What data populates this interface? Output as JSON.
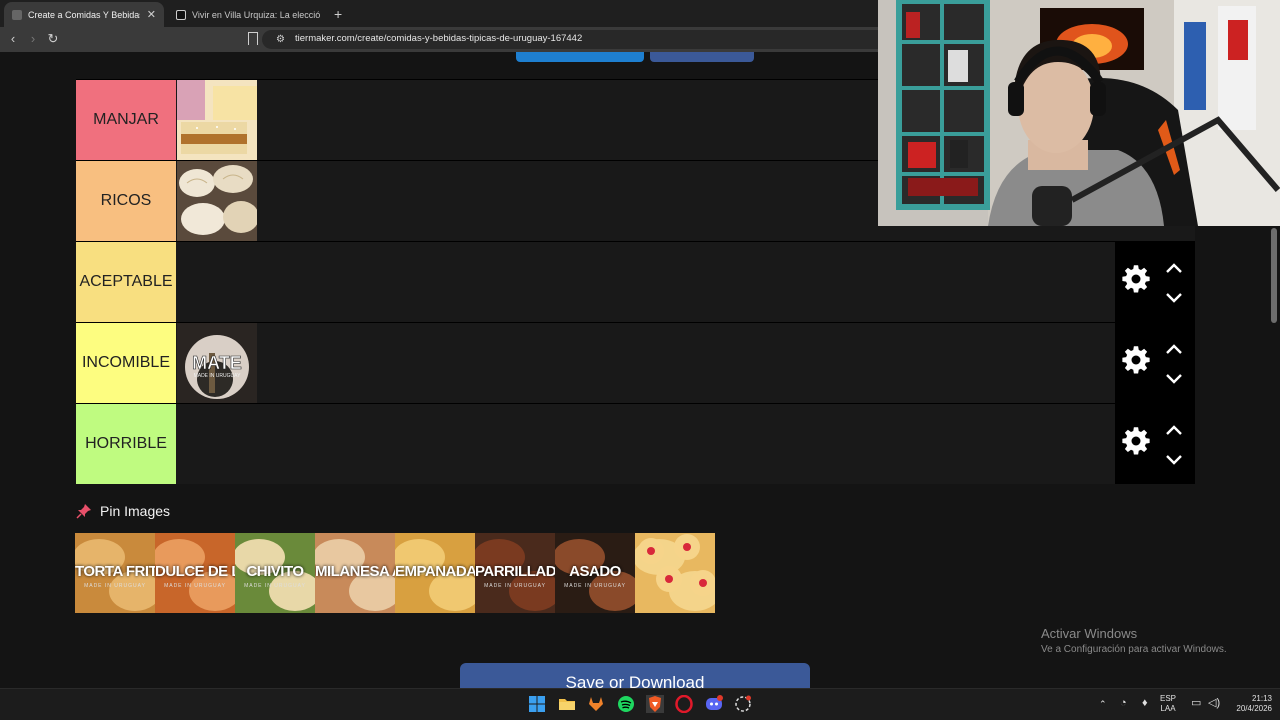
{
  "browser": {
    "tabs": [
      {
        "title": "Create a Comidas Y Bebidas Típicas de Uruguay",
        "active": true
      },
      {
        "title": "Vivir en Villa Urquiza: La elección perfecta",
        "active": false
      }
    ],
    "new_tab": "+",
    "url": "tiermaker.com/create/comidas-y-bebidas-tipicas-de-uruguay-167442",
    "nav": {
      "back": "‹",
      "forward": "›",
      "reload": "↻"
    }
  },
  "tiers": [
    {
      "label": "MANJAR",
      "color": "#f0707e",
      "has_item": true,
      "show_controls": false
    },
    {
      "label": "RICOS",
      "color": "#f8bf80",
      "has_item": true,
      "show_controls": false
    },
    {
      "label": "ACEPTABLE",
      "color": "#f8df80",
      "has_item": false,
      "show_controls": true
    },
    {
      "label": "INCOMIBLE",
      "color": "#fdfd80",
      "has_item": true,
      "show_controls": true
    },
    {
      "label": "HORRIBLE",
      "color": "#bffb80",
      "has_item": false,
      "show_controls": true
    }
  ],
  "tier_items": {
    "mate_text": "MATE",
    "made_in": "MADE IN URUGUAY"
  },
  "pin": {
    "header": "Pin Images",
    "images": [
      {
        "title": "TORTA FRITA",
        "sub": "MADE IN URUGUAY"
      },
      {
        "title": "DULCE DE LECHE",
        "sub": "MADE IN URUGUAY"
      },
      {
        "title": "CHIVITO",
        "sub": "MADE IN URUGUAY"
      },
      {
        "title": "MILANESA AL PAN",
        "sub": ""
      },
      {
        "title": "EMPANADA",
        "sub": ""
      },
      {
        "title": "PARRILLADA",
        "sub": "MADE IN URUGUAY"
      },
      {
        "title": "ASADO",
        "sub": "MADE IN URUGUAY"
      },
      {
        "title": "",
        "sub": ""
      }
    ]
  },
  "save_button": "Save or Download",
  "windows_activation": {
    "title": "Activar Windows",
    "subtitle": "Ve a Configuración para activar Windows."
  },
  "taskbar": {
    "lang_top": "ESP",
    "lang_bottom": "LAA",
    "time": "21:13",
    "date": "20/4/2026"
  },
  "colors": {
    "save_button": "#3b5998",
    "page_bg": "#141414",
    "pin_icon": "#e8506a"
  }
}
